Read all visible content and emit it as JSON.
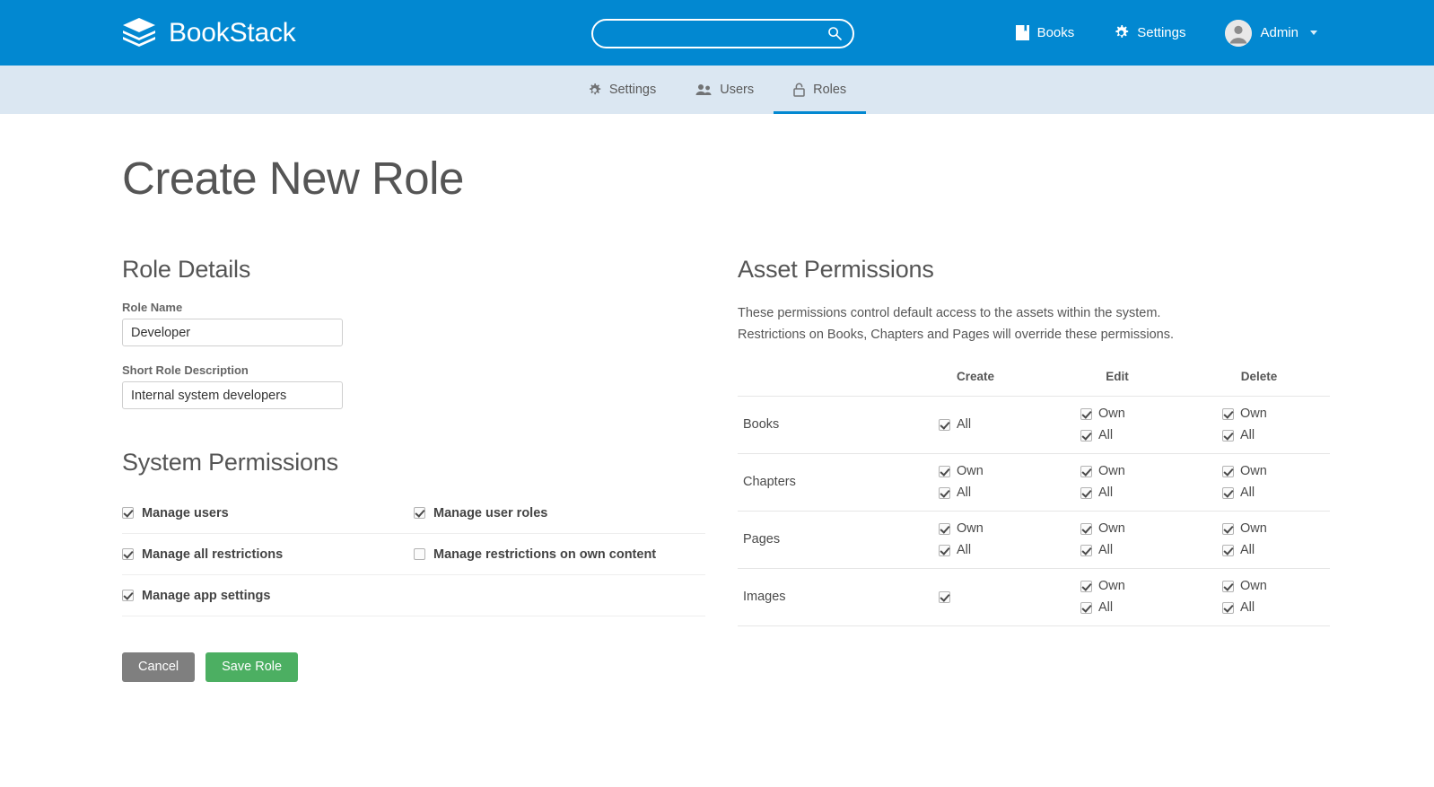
{
  "header": {
    "brand": "BookStack",
    "brand_logo_icon": "book-stack-logo-icon",
    "search": {
      "value": "",
      "placeholder": "",
      "icon": "search-icon"
    },
    "nav": [
      {
        "label": "Books",
        "icon": "book-icon"
      },
      {
        "label": "Settings",
        "icon": "gear-icon"
      }
    ],
    "user": {
      "label": "Admin",
      "avatar_icon": "user-avatar-icon",
      "caret_icon": "chevron-down-icon"
    },
    "colors": {
      "bar": "#0288d1",
      "subbar": "#dbe7f2",
      "active_underline": "#0288d1"
    }
  },
  "subnav": {
    "items": [
      {
        "label": "Settings",
        "icon": "gear-icon",
        "active": false
      },
      {
        "label": "Users",
        "icon": "users-icon",
        "active": false
      },
      {
        "label": "Roles",
        "icon": "lock-icon",
        "active": true
      }
    ]
  },
  "page": {
    "title": "Create New Role"
  },
  "role_details": {
    "heading": "Role Details",
    "name_label": "Role Name",
    "name_value": "Developer",
    "name_placeholder": "",
    "description_label": "Short Role Description",
    "description_value": "Internal system developers",
    "description_placeholder": ""
  },
  "system_permissions": {
    "heading": "System Permissions",
    "rows": [
      [
        {
          "label": "Manage users",
          "checked": true
        },
        {
          "label": "Manage user roles",
          "checked": true
        }
      ],
      [
        {
          "label": "Manage all restrictions",
          "checked": true
        },
        {
          "label": "Manage restrictions on own content",
          "checked": false
        }
      ],
      [
        {
          "label": "Manage app settings",
          "checked": true
        },
        {
          "label": "",
          "checked": null
        }
      ]
    ]
  },
  "actions": {
    "cancel_label": "Cancel",
    "save_label": "Save Role",
    "cancel_color": "#7f7f7f",
    "save_color": "#4caf62"
  },
  "asset_permissions": {
    "heading": "Asset Permissions",
    "description_line1": "These permissions control default access to the assets within the system.",
    "description_line2": "Restrictions on Books, Chapters and Pages will override these permissions.",
    "columns": [
      "Create",
      "Edit",
      "Delete"
    ],
    "rows": [
      {
        "name": "Books",
        "create": [
          {
            "label": "All",
            "checked": true
          }
        ],
        "edit": [
          {
            "label": "Own",
            "checked": true
          },
          {
            "label": "All",
            "checked": true
          }
        ],
        "delete": [
          {
            "label": "Own",
            "checked": true
          },
          {
            "label": "All",
            "checked": true
          }
        ]
      },
      {
        "name": "Chapters",
        "create": [
          {
            "label": "Own",
            "checked": true
          },
          {
            "label": "All",
            "checked": true
          }
        ],
        "edit": [
          {
            "label": "Own",
            "checked": true
          },
          {
            "label": "All",
            "checked": true
          }
        ],
        "delete": [
          {
            "label": "Own",
            "checked": true
          },
          {
            "label": "All",
            "checked": true
          }
        ]
      },
      {
        "name": "Pages",
        "create": [
          {
            "label": "Own",
            "checked": true
          },
          {
            "label": "All",
            "checked": true
          }
        ],
        "edit": [
          {
            "label": "Own",
            "checked": true
          },
          {
            "label": "All",
            "checked": true
          }
        ],
        "delete": [
          {
            "label": "Own",
            "checked": true
          },
          {
            "label": "All",
            "checked": true
          }
        ]
      },
      {
        "name": "Images",
        "create": [
          {
            "label": "",
            "checked": true
          }
        ],
        "edit": [
          {
            "label": "Own",
            "checked": true
          },
          {
            "label": "All",
            "checked": true
          }
        ],
        "delete": [
          {
            "label": "Own",
            "checked": true
          },
          {
            "label": "All",
            "checked": true
          }
        ]
      }
    ]
  }
}
